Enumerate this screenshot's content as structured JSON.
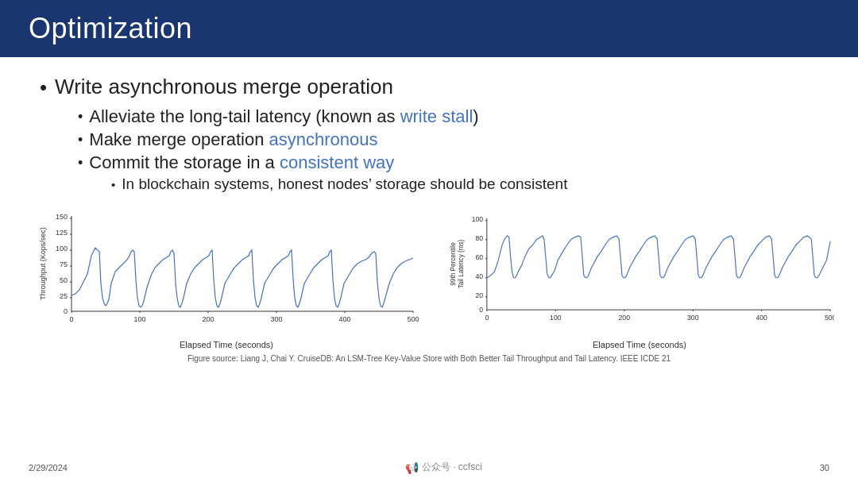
{
  "header": {
    "title": "Optimization"
  },
  "bullets": {
    "l1": "Write asynchronous merge operation",
    "l2_1_prefix": "Alleviate the long-tail latency (known as ",
    "l2_1_accent": "write stall",
    "l2_1_suffix": ")",
    "l2_2_prefix": "Make merge operation ",
    "l2_2_accent": "asynchronous",
    "l2_3_prefix": "Commit the storage in a ",
    "l2_3_accent": "consistent way",
    "l3_1": "In blockchain systems, honest nodes’ storage should be consistent"
  },
  "charts": {
    "left": {
      "y_label": "Throughput (Kops/sec)",
      "x_label": "Elapsed Time (seconds)",
      "y_ticks": [
        "150",
        "125",
        "100",
        "75",
        "50",
        "25",
        "0"
      ],
      "x_ticks": [
        "0",
        "100",
        "200",
        "300",
        "400",
        "500"
      ]
    },
    "right": {
      "y_label": "99th Percentile Tail Latency (ms)",
      "x_label": "Elapsed Time (seconds)",
      "y_ticks": [
        "100",
        "80",
        "60",
        "40",
        "20",
        "0"
      ],
      "x_ticks": [
        "0",
        "100",
        "200",
        "300",
        "400",
        "500"
      ]
    }
  },
  "figure_source": "Figure source: Liang J, Chai Y. CruiseDB: An LSM-Tree Key-Value Store with Both Better Tail Throughput and Tail Latency. IEEE ICDE 21",
  "footer": {
    "date": "2/29/2024",
    "brand": "公众号 · ccfsci",
    "page": "30"
  }
}
